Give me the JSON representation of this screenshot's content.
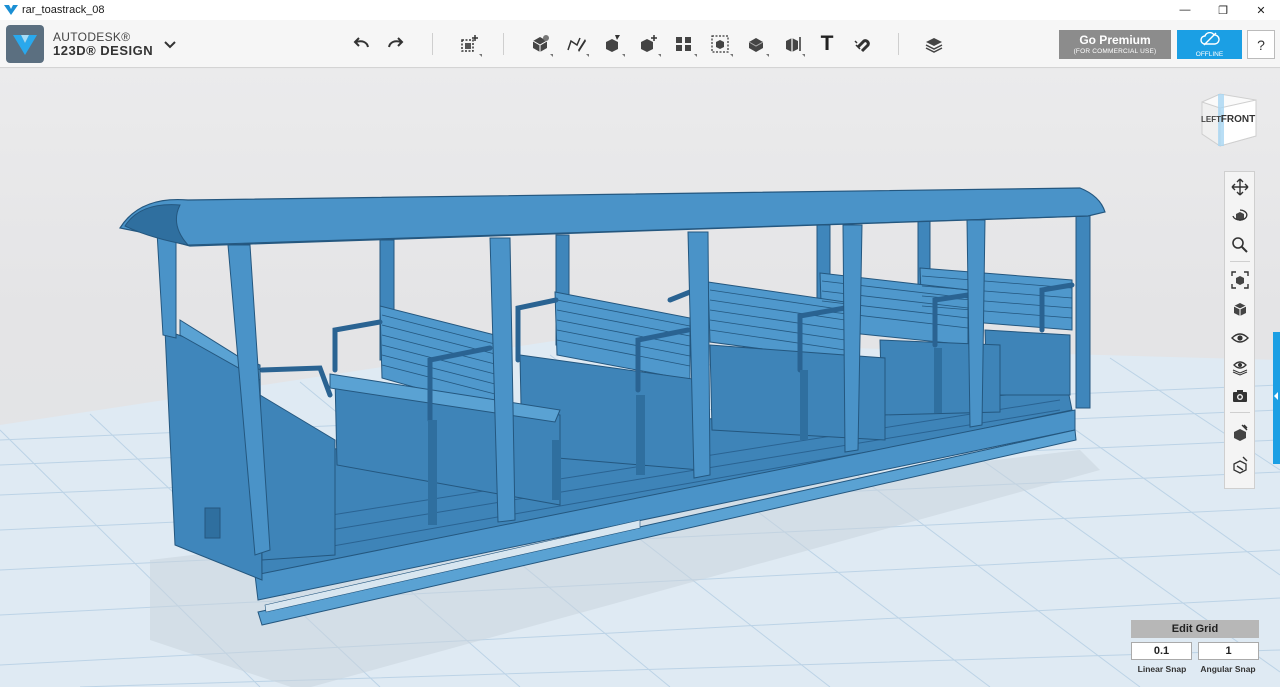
{
  "window": {
    "title": "rar_toastrack_08",
    "minimize": "—",
    "maximize": "❐",
    "close": "✕"
  },
  "brand": {
    "line1": "AUTODESK®",
    "line2": "123D® DESIGN"
  },
  "toolbar": {
    "text_tool": "T",
    "premium_label": "Go Premium",
    "premium_sub": "(FOR COMMERCIAL USE)",
    "offline_label": "OFFLINE",
    "help_label": "?"
  },
  "viewcube": {
    "left": "LEFT",
    "front": "FRONT"
  },
  "grid": {
    "edit_label": "Edit Grid",
    "linear_value": "0.1",
    "angular_value": "1",
    "linear_label": "Linear Snap",
    "angular_label": "Angular Snap"
  },
  "colors": {
    "model": "#4a93c8",
    "accent": "#1b9fe4",
    "grid": "#bcd3e6"
  }
}
